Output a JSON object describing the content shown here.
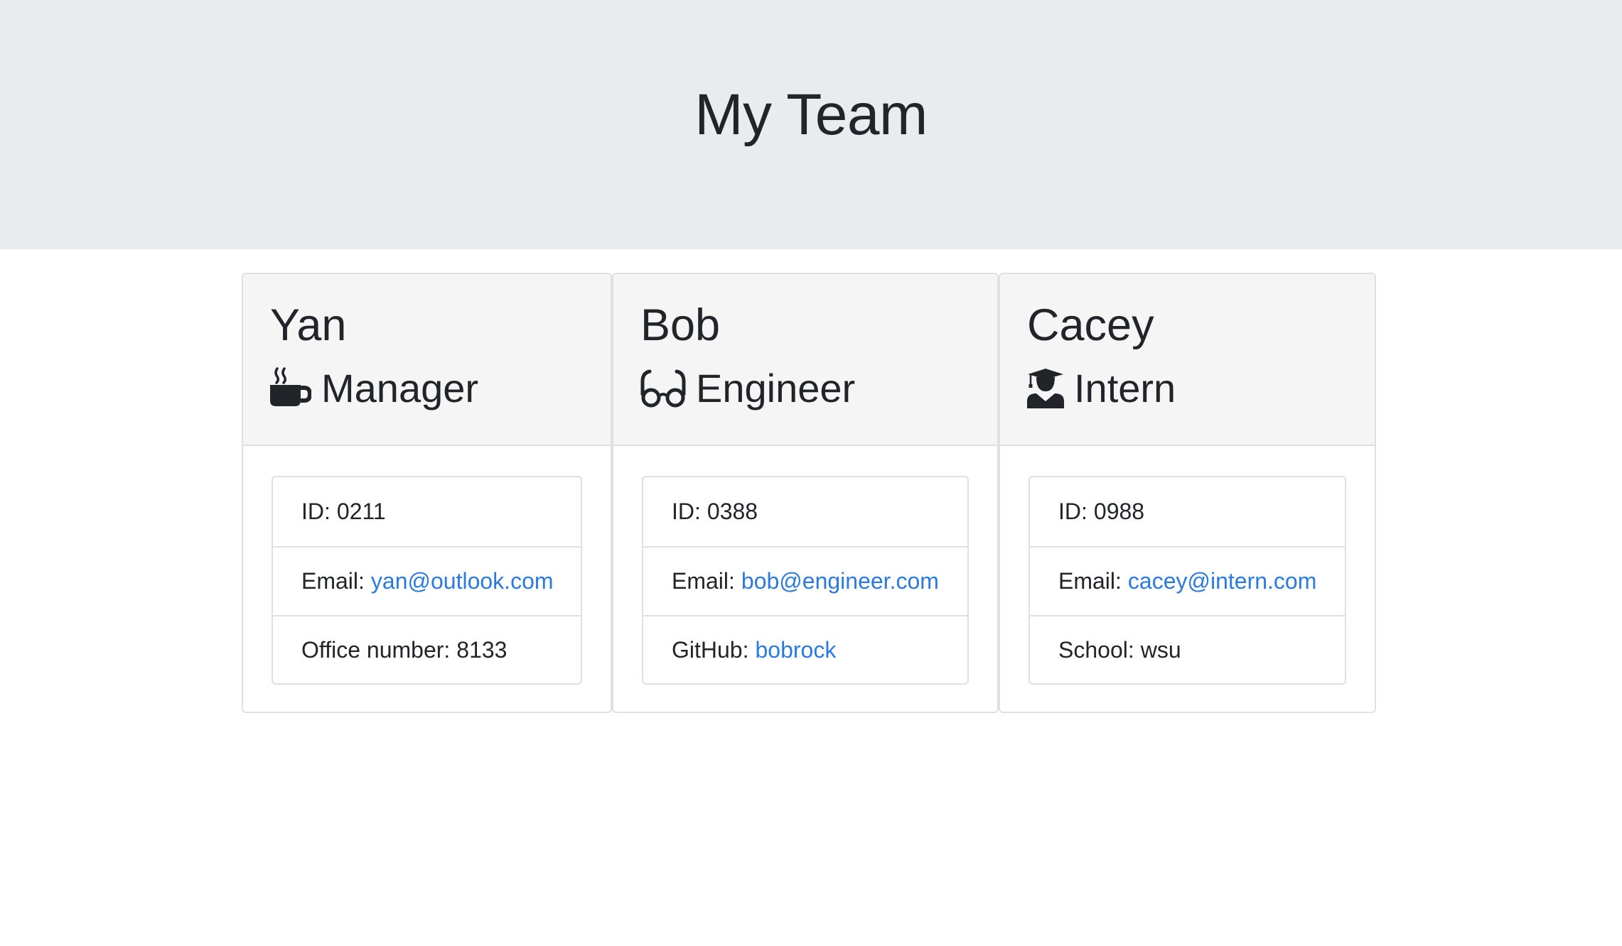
{
  "header": {
    "title": "My Team"
  },
  "employees": [
    {
      "name": "Yan",
      "role": "Manager",
      "role_icon": "mug-hot-icon",
      "id_label": "ID:",
      "id": "0211",
      "email_label": "Email:",
      "email": "yan@outlook.com",
      "extra_label": "Office number:",
      "extra_value": "8133"
    },
    {
      "name": "Bob",
      "role": "Engineer",
      "role_icon": "glasses-icon",
      "id_label": "ID:",
      "id": "0388",
      "email_label": "Email:",
      "email": "bob@engineer.com",
      "extra_label": "GitHub:",
      "extra_value": "bobrock"
    },
    {
      "name": "Cacey",
      "role": "Intern",
      "role_icon": "user-graduate-icon",
      "id_label": "ID:",
      "id": "0988",
      "email_label": "Email:",
      "email": "cacey@intern.com",
      "extra_label": "School:",
      "extra_value": "wsu"
    }
  ],
  "colors": {
    "header_bg": "#e9ecef",
    "card_header_bg": "#f5f5f5",
    "link": "#2a7ae2",
    "text": "#212529",
    "border": "#dfe0e1"
  }
}
